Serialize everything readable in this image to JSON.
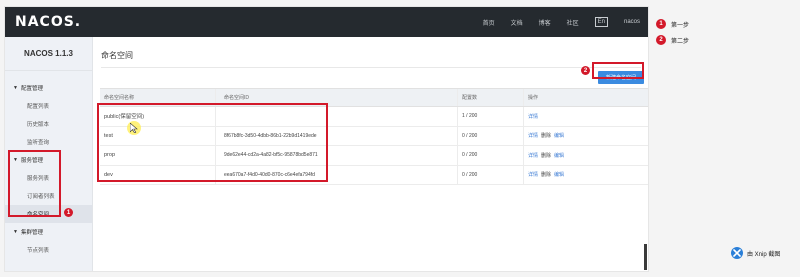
{
  "app": {
    "logo": "NACOS.",
    "version": "NACOS 1.1.3"
  },
  "topnav": [
    {
      "label": "首页"
    },
    {
      "label": "文档"
    },
    {
      "label": "博客"
    },
    {
      "label": "社区"
    },
    {
      "label": "En"
    },
    {
      "label": "nacos"
    }
  ],
  "sidebar": {
    "groups": [
      {
        "label": "配置管理",
        "items": [
          "配置列表",
          "历史版本",
          "监听查询"
        ]
      },
      {
        "label": "服务管理",
        "items": [
          "服务列表",
          "订阅者列表",
          "命名空间"
        ]
      },
      {
        "label": "集群管理",
        "items": [
          "节点列表"
        ]
      }
    ],
    "active_item": "命名空间"
  },
  "page": {
    "title": "命名空间",
    "new_button": "新建命名空间",
    "columns": [
      "命名空间名称",
      "命名空间ID",
      "配置数",
      "操作"
    ],
    "rows": [
      {
        "name": "public(保留空间)",
        "id": "",
        "count": "1 / 200",
        "actions": [
          "详情"
        ]
      },
      {
        "name": "test",
        "id": "8f67b8fc-3d50-4dbb-86b1-22b9d1419ede",
        "count": "0 / 200",
        "actions": [
          "详情",
          "删除",
          "编辑"
        ]
      },
      {
        "name": "prop",
        "id": "9de62e44-cd2a-4a82-bf5c-95878bd5e871",
        "count": "0 / 200",
        "actions": [
          "详情",
          "删除",
          "编辑"
        ]
      },
      {
        "name": "dev",
        "id": "eea670a7-f4d0-40d0-870c-c6e4efa794fd",
        "count": "0 / 200",
        "actions": [
          "详情",
          "删除",
          "编辑"
        ]
      }
    ]
  },
  "annotations": {
    "badges": [
      "1",
      "2"
    ],
    "legend": [
      {
        "num": "1",
        "text": "第一步"
      },
      {
        "num": "2",
        "text": "第二步"
      }
    ],
    "highlight_color": "#d3192a"
  },
  "watermark": {
    "text": "由 Xnip 截图",
    "icon": "xnip-logo-icon"
  },
  "colors": {
    "topbar": "#252a2f",
    "primary": "#3b8be0",
    "link": "#3b7bd4",
    "annotation": "#d3192a"
  }
}
